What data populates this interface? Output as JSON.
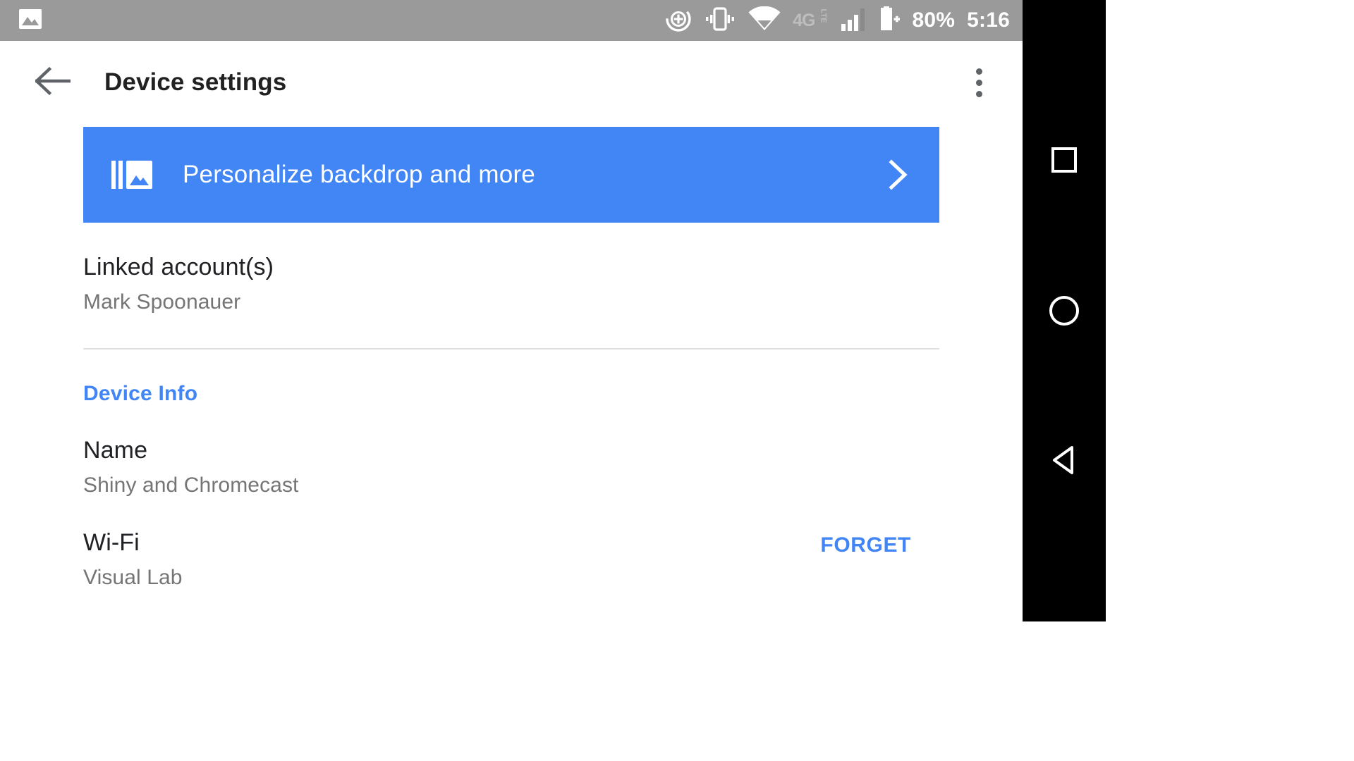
{
  "status_bar": {
    "background_color": "#9a9a9a",
    "left_icons": [
      {
        "name": "photo-image-icon",
        "label": "image"
      }
    ],
    "right_icons": [
      {
        "name": "location-add-icon",
        "label": "location-report"
      },
      {
        "name": "vibrate-icon",
        "label": "vibrate-mode"
      },
      {
        "name": "wifi-icon",
        "label": "wifi-connected"
      },
      {
        "name": "network-type-icon",
        "label": "4G LTE"
      },
      {
        "name": "cell-signal-icon",
        "label": "signal-bars"
      },
      {
        "name": "battery-charging-icon",
        "label": "battery"
      }
    ],
    "network_type": "4G",
    "network_type_suffix": "LTE",
    "battery_percent": "80%",
    "clock": "5:16"
  },
  "app_bar": {
    "back_icon": "arrow-left-icon",
    "title": "Device settings",
    "overflow_icon": "more-vertical-icon"
  },
  "banner": {
    "icon": "backdrop-image-icon",
    "label": "Personalize backdrop and more",
    "chevron_icon": "chevron-right-icon",
    "background_color": "#4285f4",
    "text_color": "#ffffff"
  },
  "linked_accounts": {
    "title": "Linked account(s)",
    "value": "Mark Spoonauer"
  },
  "device_info": {
    "section_title": "Device Info",
    "section_color": "#4285f4",
    "rows": [
      {
        "title": "Name",
        "value": "Shiny and Chromecast",
        "action": null
      },
      {
        "title": "Wi-Fi",
        "value": "Visual Lab",
        "action": "FORGET"
      }
    ]
  },
  "nav_bar": {
    "background_color": "#000000",
    "buttons": [
      {
        "name": "recents-button",
        "icon": "square-icon"
      },
      {
        "name": "home-button",
        "icon": "circle-icon"
      },
      {
        "name": "back-button",
        "icon": "triangle-left-icon"
      }
    ]
  },
  "theme": {
    "accent": "#4285f4",
    "primary_text": "#202124",
    "secondary_text": "#757575",
    "divider": "#e0e0e0",
    "surface": "#ffffff"
  }
}
